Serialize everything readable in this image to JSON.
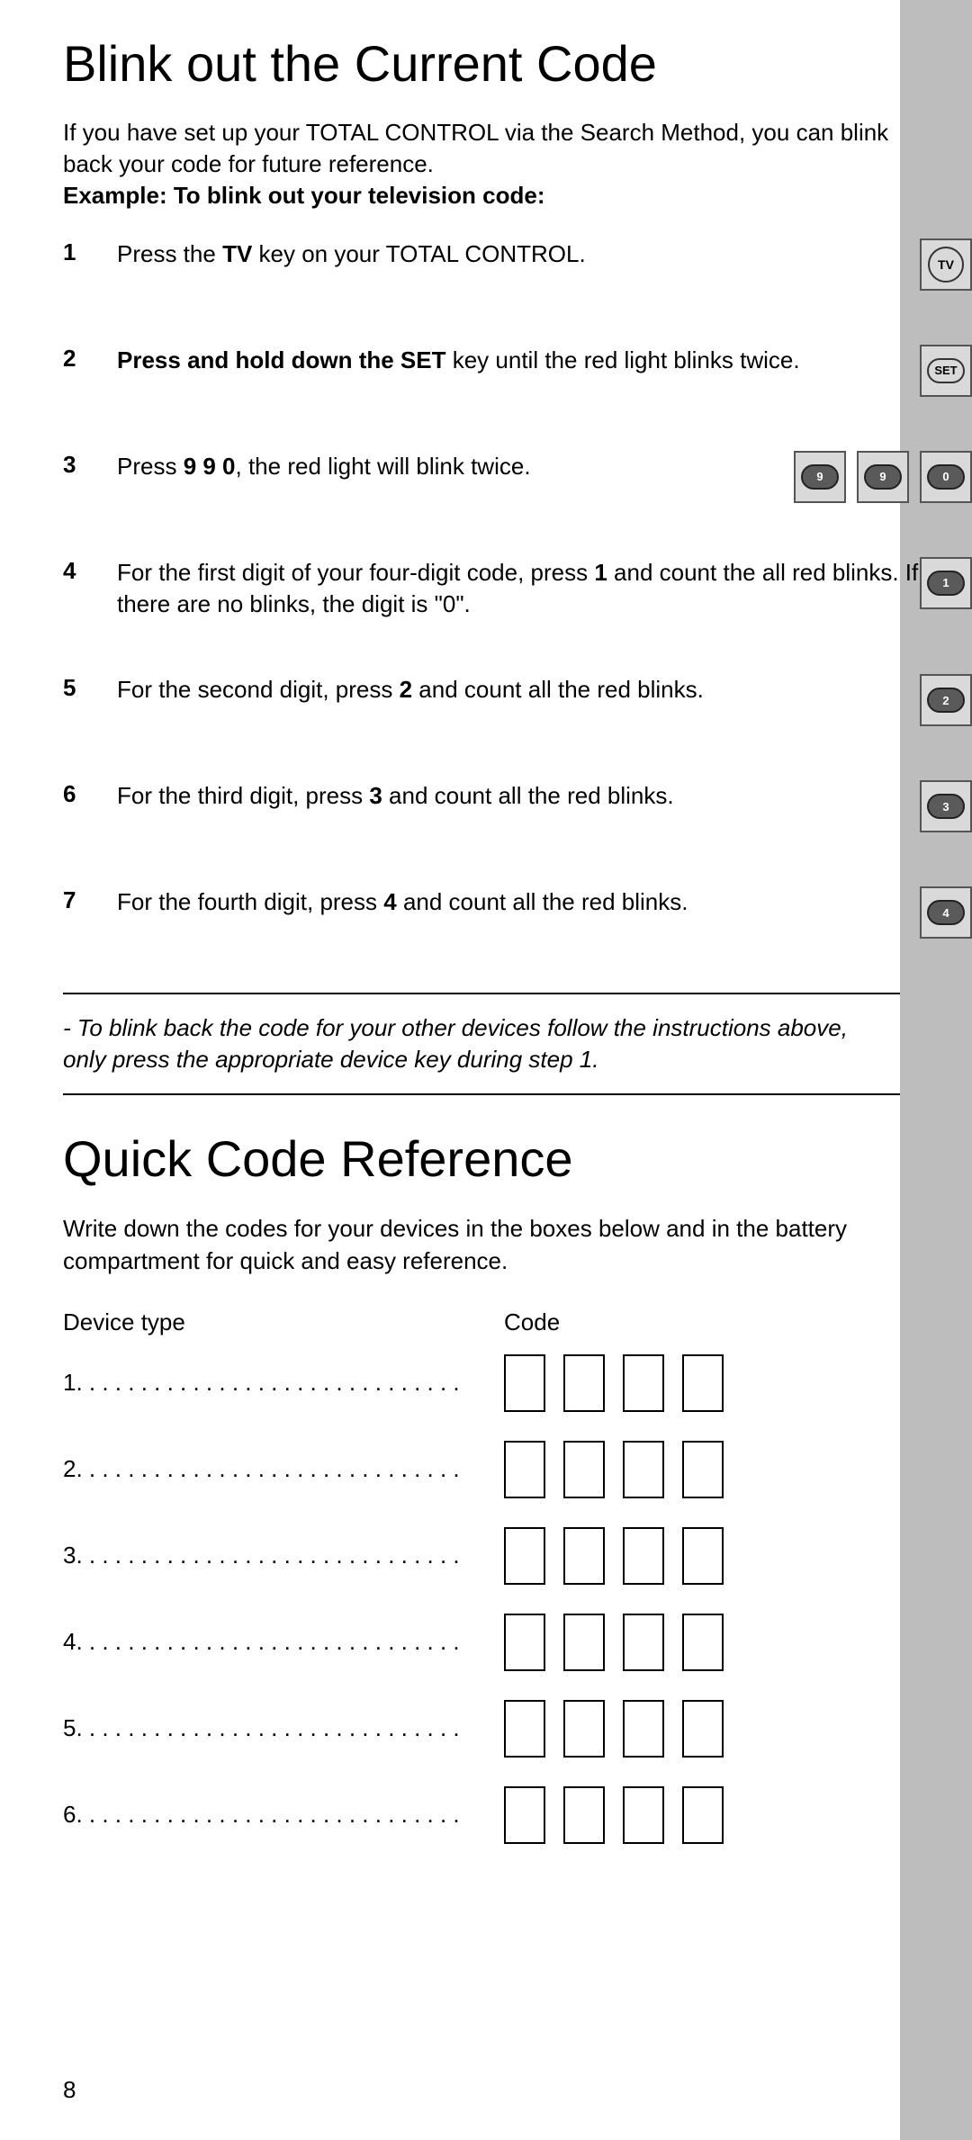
{
  "page_number": "8",
  "section1": {
    "title": "Blink out the Current Code",
    "intro_line1": "If you have set up your TOTAL CONTROL via the Search Method, you can blink back your code for future reference.",
    "intro_bold": "Example: To blink out your television code:"
  },
  "steps": [
    {
      "n": "1",
      "html": "Press the <b>TV</b> key on your TOTAL CONTROL.",
      "keys": [
        {
          "label": "TV",
          "dark": false,
          "round": true
        }
      ]
    },
    {
      "n": "2",
      "html": "<b>Press and hold down the SET</b> key until the red light blinks twice.",
      "keys": [
        {
          "label": "SET",
          "dark": false
        }
      ]
    },
    {
      "n": "3",
      "html": "Press <b>9 9 0</b>, the red light will blink twice.",
      "keys": [
        {
          "label": "9",
          "dark": true
        },
        {
          "label": "9",
          "dark": true
        },
        {
          "label": "0",
          "dark": true
        }
      ]
    },
    {
      "n": "4",
      "html": "For the first digit of your four-digit code, press <b>1</b> and count the all red blinks. If there are no blinks, the digit is \"0\".",
      "keys": [
        {
          "label": "1",
          "dark": true
        }
      ]
    },
    {
      "n": "5",
      "html": "For the second digit, press <b>2</b> and count all the red blinks.",
      "keys": [
        {
          "label": "2",
          "dark": true
        }
      ]
    },
    {
      "n": "6",
      "html": "For the third digit, press <b>3</b> and count all the red blinks.",
      "keys": [
        {
          "label": "3",
          "dark": true
        }
      ]
    },
    {
      "n": "7",
      "html": "For the fourth digit, press <b>4</b> and count all the red blinks.",
      "keys": [
        {
          "label": "4",
          "dark": true
        }
      ]
    }
  ],
  "footnote": "-  To blink back the code for your other devices follow the instructions above, only press the appropriate device key during step 1.",
  "section2": {
    "title": "Quick Code Reference",
    "intro": "Write down the codes for your devices in the boxes below and in the battery compartment for quick and easy reference.",
    "col1": "Device type",
    "col2": "Code",
    "rows": [
      "1.",
      "2.",
      "3.",
      "4.",
      "5.",
      "6."
    ]
  },
  "dots": " . . . . . . . . . . . . . . . . . . . . . . . . . . . . ."
}
